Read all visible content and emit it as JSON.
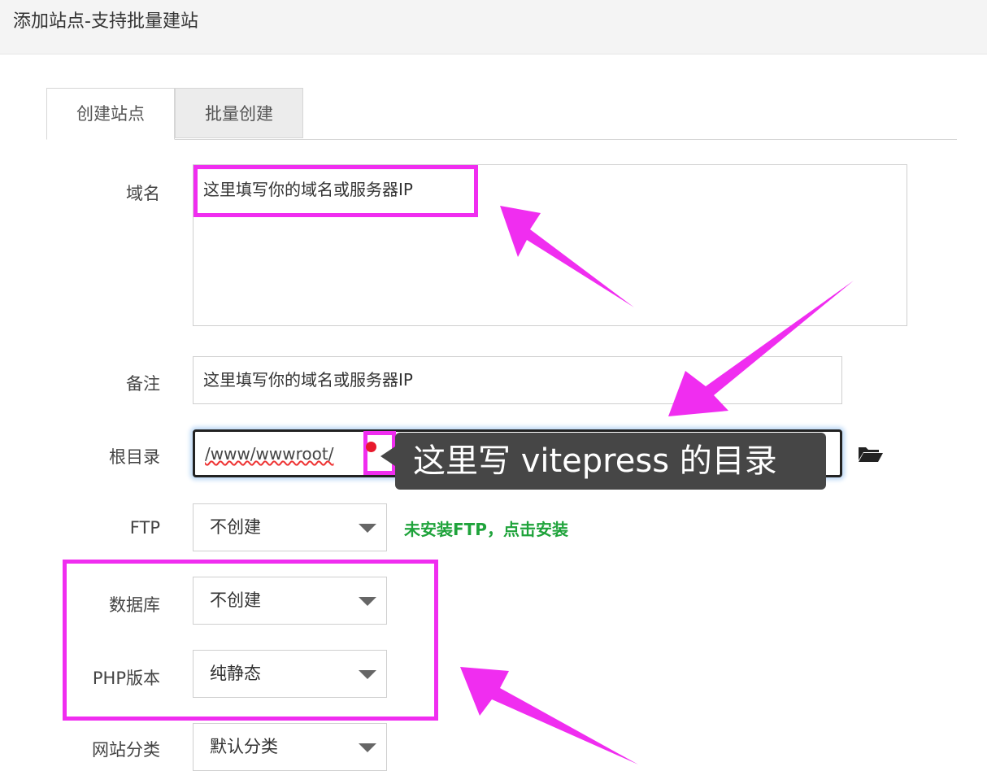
{
  "header": {
    "title": "添加站点-支持批量建站"
  },
  "tabs": [
    {
      "label": "创建站点",
      "active": true
    },
    {
      "label": "批量创建",
      "active": false
    }
  ],
  "form": {
    "domain": {
      "label": "域名",
      "value": "这里填写你的域名或服务器IP"
    },
    "remark": {
      "label": "备注",
      "value": "这里填写你的域名或服务器IP"
    },
    "root": {
      "label": "根目录",
      "value": "/www/wwwroot/"
    },
    "ftp": {
      "label": "FTP",
      "selected": "不创建",
      "install_link": "未安装FTP，点击安装"
    },
    "database": {
      "label": "数据库",
      "selected": "不创建"
    },
    "php": {
      "label": "PHP版本",
      "selected": "纯静态"
    },
    "category": {
      "label": "网站分类",
      "selected": "默认分类"
    }
  },
  "annotations": {
    "tooltip": "这里写 vitepress 的目录",
    "highlight_color": "#f02df0"
  },
  "icons": {
    "folder": "folder-open-icon",
    "dropdown": "caret-down-icon"
  }
}
